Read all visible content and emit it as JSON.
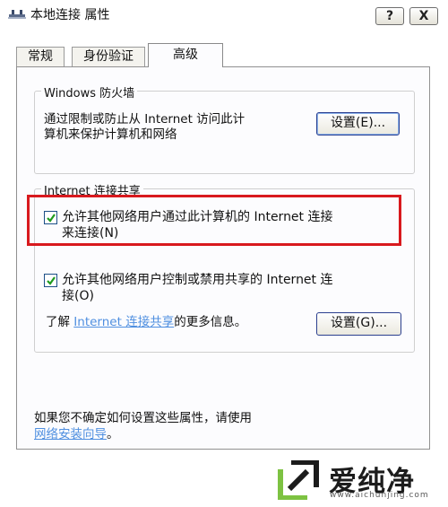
{
  "window": {
    "title": "本地连接 属性",
    "help_glyph": "?",
    "close_glyph": "X"
  },
  "tabs": [
    {
      "label": "常规",
      "active": false
    },
    {
      "label": "身份验证",
      "active": false
    },
    {
      "label": "高级",
      "active": true
    }
  ],
  "firewall": {
    "group_title": "Windows 防火墙",
    "description_line1": "通过限制或防止从 Internet 访问此计",
    "description_line2": "算机来保护计算机和网络",
    "settings_button": "设置(E)..."
  },
  "ics": {
    "group_title": "Internet 连接共享",
    "allow_connect": {
      "line1": "允许其他网络用户通过此计算机的 Internet 连接",
      "line2": "来连接(N)",
      "checked": true
    },
    "allow_control": {
      "line1": "允许其他网络用户控制或禁用共享的 Internet 连",
      "line2": "接(O)",
      "checked": true
    },
    "learn_more_prefix": "了解 ",
    "learn_more_link": "Internet 连接共享",
    "learn_more_suffix": "的更多信息。",
    "settings_button": "设置(G)..."
  },
  "footer": {
    "text": "如果您不确定如何设置这些属性，请使用",
    "wizard_link": "网络安装向导",
    "wizard_suffix": "。"
  },
  "watermark": {
    "brand": "爱纯净",
    "domain": "www.aichunjing.com",
    "accent_color": "#7dc242"
  },
  "colors": {
    "highlight_box": "#d8191e",
    "link": "#4f8fe0"
  }
}
